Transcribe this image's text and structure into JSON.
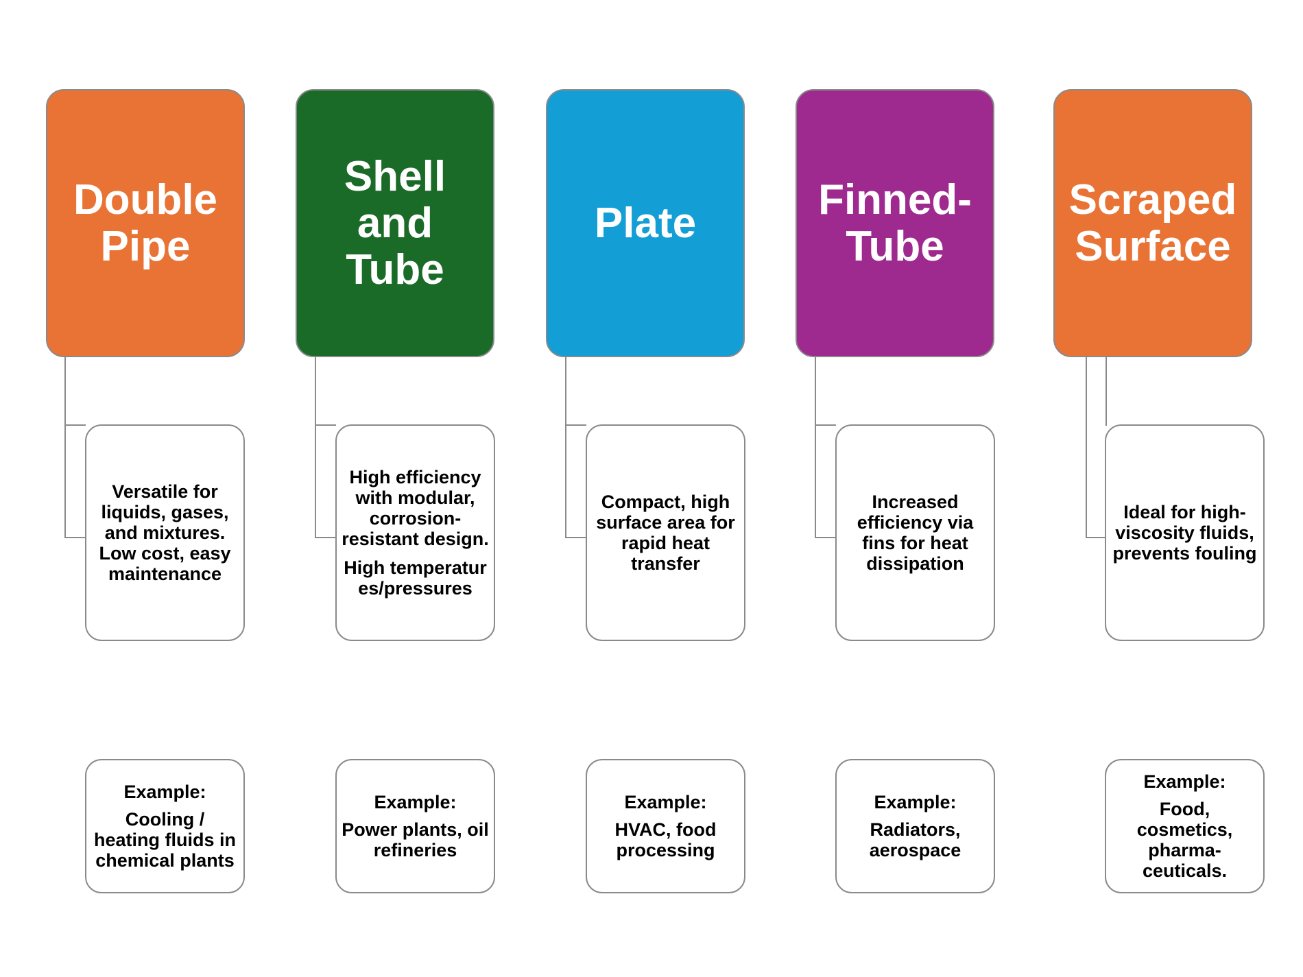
{
  "diagram": {
    "type": "heat exchanger types comparison",
    "columns": [
      {
        "title": "Double Pipe",
        "color": "#e87334",
        "description": [
          "Versatile for liquids, gases, and mixtures. Low cost, easy maintenance"
        ],
        "example_label": "Example:",
        "example": "Cooling / heating fluids in chemical plants"
      },
      {
        "title": "Shell and Tube",
        "color": "#1b6b28",
        "description": [
          "High efficiency with modular, corrosion-resistant design.",
          "High temperatures/pressures"
        ],
        "example_label": "Example:",
        "example": "Power plants, oil refineries"
      },
      {
        "title": "Plate",
        "color": "#139ed6",
        "description": [
          "Compact, high surface area for rapid heat transfer"
        ],
        "example_label": "Example:",
        "example": "HVAC, food processing"
      },
      {
        "title": "Finned-Tube",
        "color": "#9e2a8f",
        "description": [
          "Increased efficiency via fins for heat dissipation"
        ],
        "example_label": "Example:",
        "example": "Radiators, aerospace"
      },
      {
        "title": "Scraped Surface",
        "color": "#e87334",
        "description": [
          "Ideal for high-viscosity fluids, prevents fouling"
        ],
        "example_label": "Example:",
        "example": "Food, cosmetics, pharma-ceuticals."
      }
    ]
  }
}
